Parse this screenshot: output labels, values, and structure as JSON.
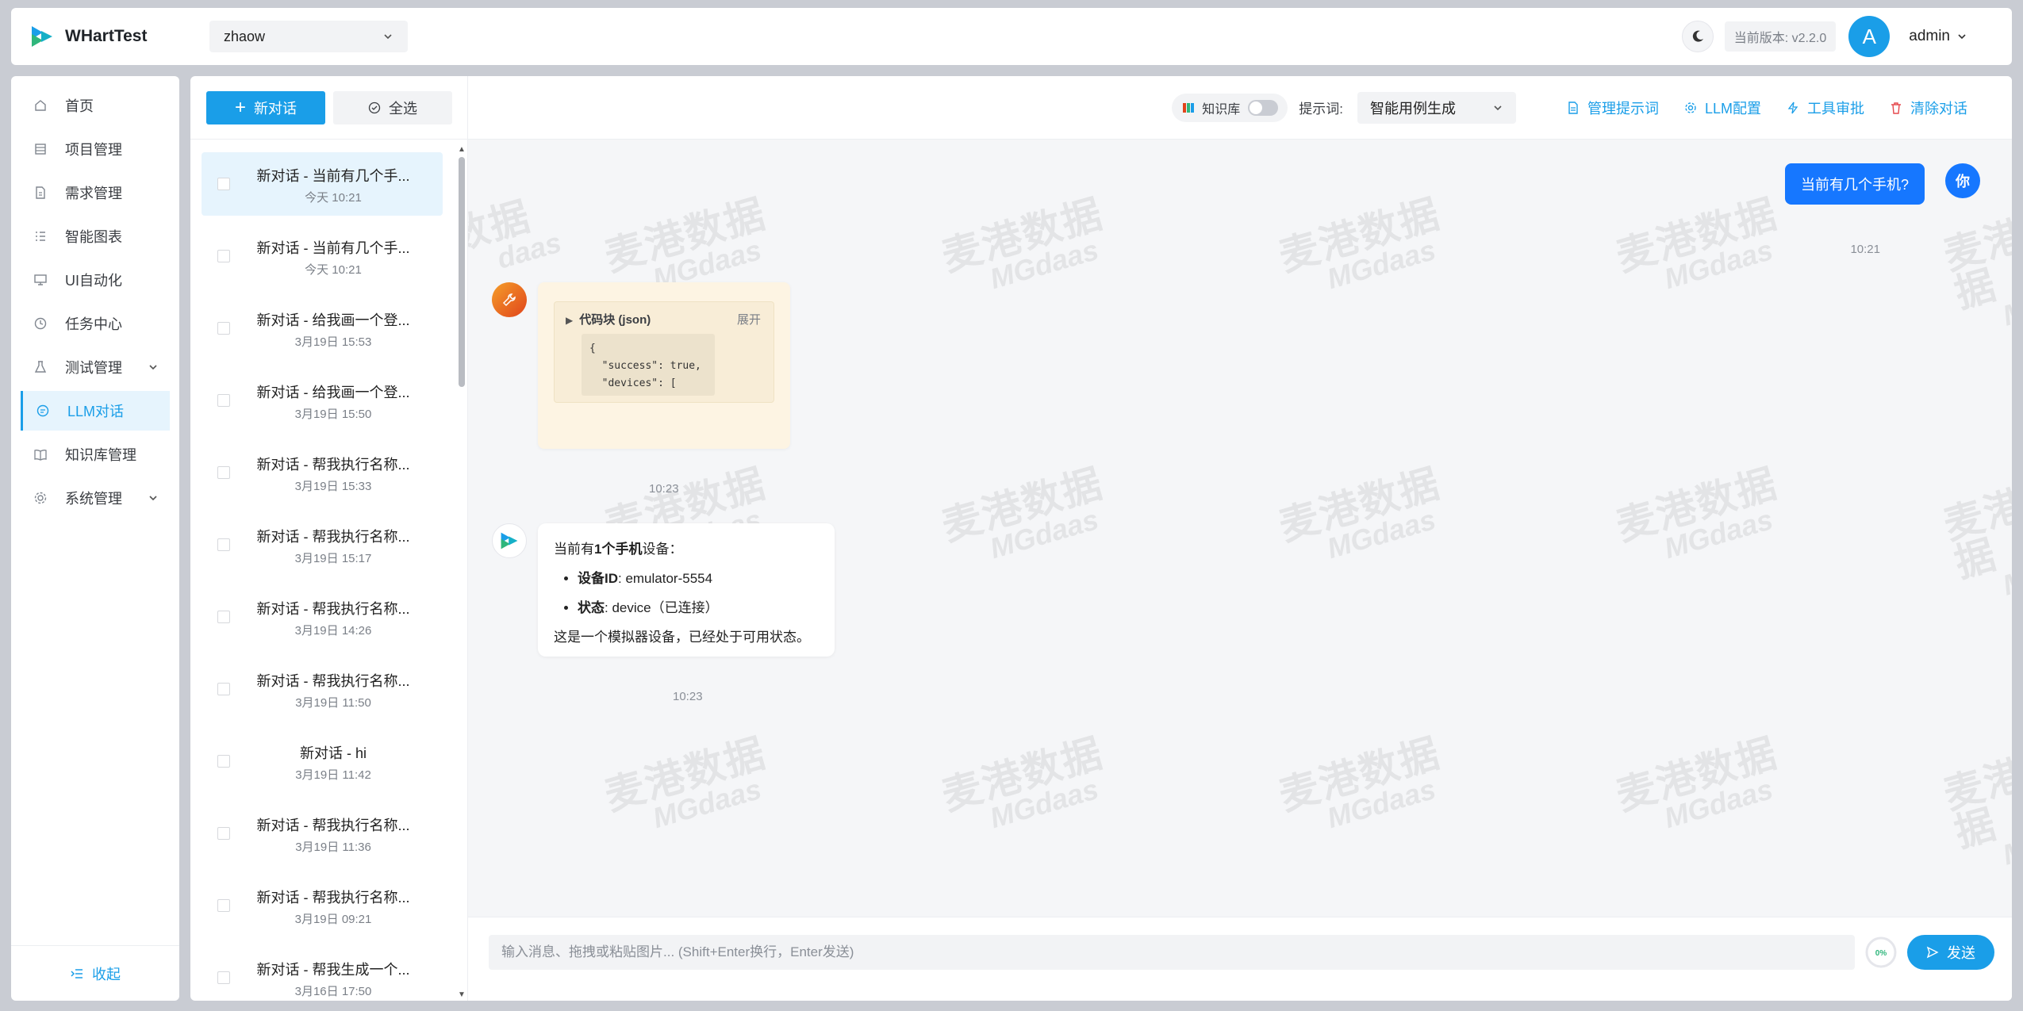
{
  "app": {
    "title": "WHartTest",
    "project": "zhaow",
    "version_label": "当前版本: v2.2.0",
    "avatar_letter": "A",
    "user": "admin",
    "accent": "#1a9ee8"
  },
  "sidebar": {
    "items": [
      {
        "label": "首页",
        "icon": "home-icon"
      },
      {
        "label": "项目管理",
        "icon": "project-icon"
      },
      {
        "label": "需求管理",
        "icon": "requirement-icon"
      },
      {
        "label": "智能图表",
        "icon": "chart-list-icon"
      },
      {
        "label": "UI自动化",
        "icon": "monitor-icon"
      },
      {
        "label": "任务中心",
        "icon": "clock-icon"
      },
      {
        "label": "测试管理",
        "icon": "flask-icon"
      },
      {
        "label": "LLM对话",
        "icon": "chat-icon"
      },
      {
        "label": "知识库管理",
        "icon": "book-icon"
      },
      {
        "label": "系统管理",
        "icon": "settings-icon"
      }
    ],
    "active_index": 7,
    "collapse_label": "收起"
  },
  "conversations": {
    "new_label": "新对话",
    "select_all_label": "全选",
    "items": [
      {
        "title": "新对话 - 当前有几个手...",
        "time": "今天 10:21"
      },
      {
        "title": "新对话 - 当前有几个手...",
        "time": "今天 10:21"
      },
      {
        "title": "新对话 - 给我画一个登...",
        "time": "3月19日 15:53"
      },
      {
        "title": "新对话 - 给我画一个登...",
        "time": "3月19日 15:50"
      },
      {
        "title": "新对话 - 帮我执行名称...",
        "time": "3月19日 15:33"
      },
      {
        "title": "新对话 - 帮我执行名称...",
        "time": "3月19日 15:17"
      },
      {
        "title": "新对话 - 帮我执行名称...",
        "time": "3月19日 14:26"
      },
      {
        "title": "新对话 - 帮我执行名称...",
        "time": "3月19日 11:50"
      },
      {
        "title": "新对话 - hi",
        "time": "3月19日 11:42"
      },
      {
        "title": "新对话 - 帮我执行名称...",
        "time": "3月19日 11:36"
      },
      {
        "title": "新对话 - 帮我执行名称...",
        "time": "3月19日 09:21"
      },
      {
        "title": "新对话 - 帮我生成一个...",
        "time": "3月16日 17:50"
      }
    ]
  },
  "toolbar": {
    "kb_label": "知识库",
    "prompt_label": "提示词:",
    "prompt_value": "智能用例生成",
    "manage_prompts": "管理提示词",
    "llm_config": "LLM配置",
    "tool_approval": "工具审批",
    "clear_chat": "清除对话"
  },
  "messages": {
    "user_text": "当前有几个手机?",
    "user_avatar": "你",
    "user_time": "10:21",
    "tool_block_title": "代码块 (json)",
    "tool_expand": "展开",
    "tool_code": "{\n  \"success\": true,\n  \"devices\": [",
    "tool_time": "10:23",
    "bot_intro_prefix": "当前有",
    "bot_intro_bold": "1个手机",
    "bot_intro_suffix": "设备：",
    "bot_li1_key": "设备ID",
    "bot_li1_val": ": emulator-5554",
    "bot_li2_key": "状态",
    "bot_li2_val": ": device（已连接）",
    "bot_outro": "这是一个模拟器设备，已经处于可用状态。",
    "bot_time": "10:23"
  },
  "watermark": {
    "cn": "麦港数据",
    "en": "MGdaas",
    "partial_cn": "数据",
    "partial_en": "daas"
  },
  "input": {
    "placeholder": "输入消息、拖拽或粘贴图片... (Shift+Enter换行，Enter发送)",
    "progress": "0%",
    "progress_fraction": 0,
    "send_label": "发送"
  }
}
